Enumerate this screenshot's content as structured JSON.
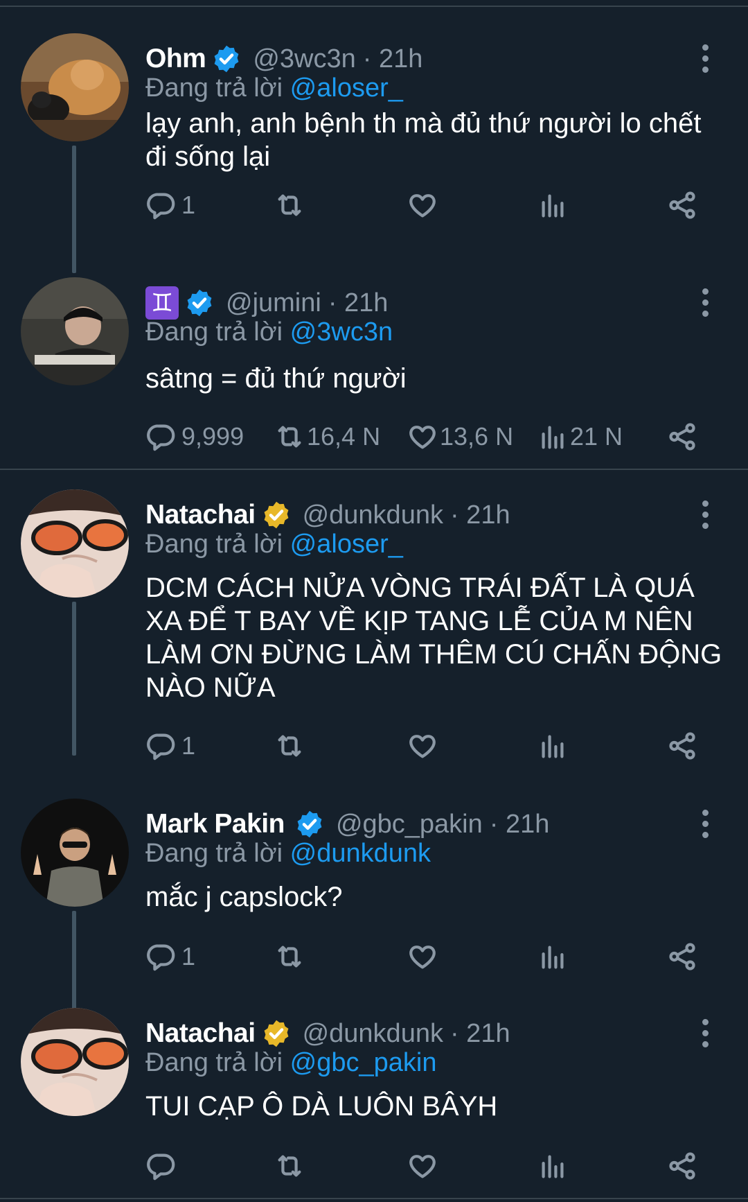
{
  "colors": {
    "background": "#15202b",
    "divider": "#38444d",
    "muted_text": "#8b98a5",
    "link_blue": "#1d9bf0",
    "verified_blue": "#1d9bf0",
    "verified_gold": "#e8b829"
  },
  "reply_prefix": "Đang trả lời",
  "tweets": [
    {
      "name": "Ohm",
      "badge": "verified-blue-icon",
      "handle": "@3wc3n",
      "time": "· 21h",
      "reply_to": "@aloser_",
      "text": "lạy anh, anh bệnh th mà đủ thứ người lo chết đi sống lại",
      "counts": {
        "reply": "1",
        "retweet": "",
        "like": "",
        "views": ""
      }
    },
    {
      "name": "♊",
      "badge": "verified-blue-icon",
      "handle": "@jumini",
      "time": "· 21h",
      "reply_to": "@3wc3n",
      "text": "sâtng = đủ thứ người",
      "counts": {
        "reply": "9,999",
        "retweet": "16,4 N",
        "like": "13,6 N",
        "views": "21 N"
      }
    },
    {
      "name": "Natachai",
      "badge": "verified-gold-icon",
      "handle": "@dunkdunk",
      "time": "· 21h",
      "reply_to": "@aloser_",
      "text": "DCM CÁCH NỬA VÒNG TRÁI ĐẤT LÀ QUÁ XA ĐỂ T BAY VỀ KỊP TANG LỄ CỦA M NÊN LÀM ƠN ĐỪNG LÀM THÊM CÚ CHẤN ĐỘNG NÀO NỮA",
      "counts": {
        "reply": "1",
        "retweet": "",
        "like": "",
        "views": ""
      }
    },
    {
      "name": "Mark Pakin",
      "badge": "verified-blue-icon",
      "handle": "@gbc_pakin",
      "time": "· 21h",
      "reply_to": "@dunkdunk",
      "text": "mắc j capslock?",
      "counts": {
        "reply": "1",
        "retweet": "",
        "like": "",
        "views": ""
      }
    },
    {
      "name": "Natachai",
      "badge": "verified-gold-icon",
      "handle": "@dunkdunk",
      "time": "· 21h",
      "reply_to": "@gbc_pakin",
      "text": "TUI CẠP Ô DÀ LUÔN BÂYH",
      "counts": {
        "reply": "",
        "retweet": "",
        "like": "",
        "views": ""
      }
    }
  ]
}
